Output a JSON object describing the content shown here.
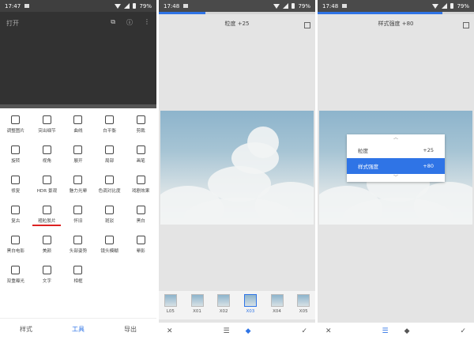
{
  "panel1": {
    "status_time": "17:47",
    "battery": "79%",
    "title": "打开",
    "tools": [
      "调整图片",
      "突出细节",
      "曲线",
      "白平衡",
      "剪裁",
      "旋转",
      "视角",
      "展开",
      "局部",
      "画笔",
      "修复",
      "HDR 景观",
      "魅力光晕",
      "色调对比度",
      "戏剧效果",
      "复古",
      "粗粒胶片",
      "怀旧",
      "斑驳",
      "黑白",
      "黑白电影",
      "美颜",
      "头部姿势",
      "镜头模糊",
      "晕影",
      "双重曝光",
      "文字",
      "相框"
    ],
    "nav": [
      "样式",
      "工具",
      "导出"
    ]
  },
  "panel2": {
    "status_time": "17:48",
    "battery": "79%",
    "title": "粒度 +25",
    "thumbs": [
      "L05",
      "X01",
      "X02",
      "X03",
      "X04",
      "X05"
    ],
    "progress_fraction": 0.3
  },
  "panel3": {
    "status_time": "17:48",
    "battery": "79%",
    "title": "样式强度 +80",
    "popup": [
      {
        "label": "粒度",
        "value": "+25"
      },
      {
        "label": "样式强度",
        "value": "+80"
      }
    ],
    "progress_fraction": 0.8
  },
  "icons": {
    "close": "close-icon",
    "check": "check-icon",
    "sliders": "sliders-icon",
    "style": "style-icon",
    "compare": "compare-icon"
  },
  "colors": {
    "accent": "#2f74e6",
    "underline": "#d22222"
  }
}
